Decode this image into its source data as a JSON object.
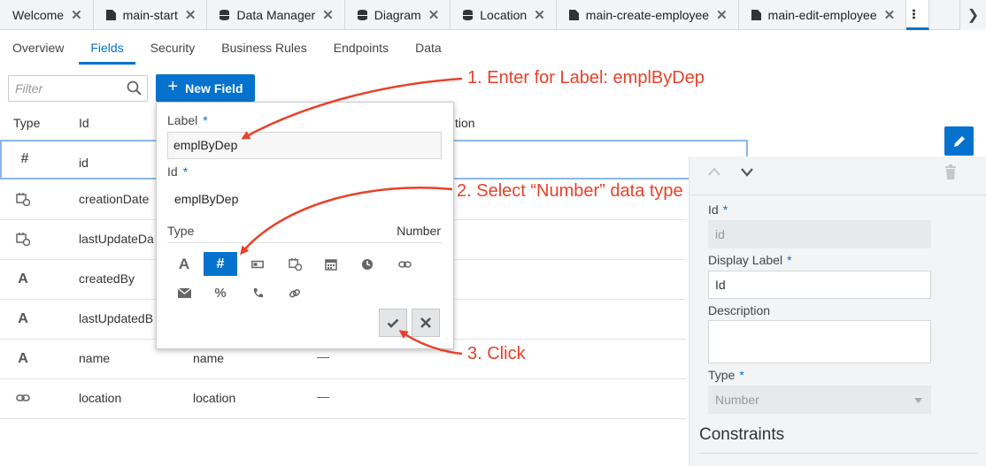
{
  "tabs": [
    {
      "label": "Welcome",
      "icon": "none"
    },
    {
      "label": "main-start",
      "icon": "page-icon"
    },
    {
      "label": "Data Manager",
      "icon": "database-icon"
    },
    {
      "label": "Diagram",
      "icon": "database-icon"
    },
    {
      "label": "Location",
      "icon": "database-icon"
    },
    {
      "label": "main-create-employee",
      "icon": "page-icon"
    },
    {
      "label": "main-edit-employee",
      "icon": "page-icon"
    }
  ],
  "subtabs": [
    "Overview",
    "Fields",
    "Security",
    "Business Rules",
    "Endpoints",
    "Data"
  ],
  "active_subtab": "Fields",
  "filter": {
    "placeholder": "Filter"
  },
  "new_field_label": "New Field",
  "table": {
    "headers": {
      "type": "Type",
      "id": "Id",
      "description_partial": "tion"
    },
    "rows": [
      {
        "icon": "#",
        "id": "id",
        "label": "",
        "desc": ""
      },
      {
        "icon": "datetime",
        "id": "creationDate",
        "label": "",
        "desc": ""
      },
      {
        "icon": "datetime",
        "id": "lastUpdateDa",
        "label": "",
        "desc": ""
      },
      {
        "icon": "A",
        "id": "createdBy",
        "label": "",
        "desc": ""
      },
      {
        "icon": "A",
        "id": "lastUpdatedB",
        "label": "",
        "desc": ""
      },
      {
        "icon": "A",
        "id": "name",
        "label": "name",
        "desc": "—"
      },
      {
        "icon": "link",
        "id": "location",
        "label": "location",
        "desc": "—"
      }
    ]
  },
  "popup": {
    "label_title": "Label",
    "label_value": "emplByDep",
    "id_title": "Id",
    "id_value": "emplByDep",
    "type_title": "Type",
    "type_selected": "Number",
    "required_mark": "*"
  },
  "panel": {
    "id_label": "Id",
    "id_value": "id",
    "display_label_label": "Display Label",
    "display_label_value": "Id",
    "description_label": "Description",
    "type_label": "Type",
    "type_value": "Number",
    "constraints": "Constraints",
    "required_mark": "*"
  },
  "annotations": {
    "step1": "1. Enter for Label: emplByDep",
    "step2": "2. Select “Number” data type",
    "step3": "3. Click"
  },
  "colors": {
    "accent": "#0572ce",
    "annotation": "#e8412a"
  }
}
